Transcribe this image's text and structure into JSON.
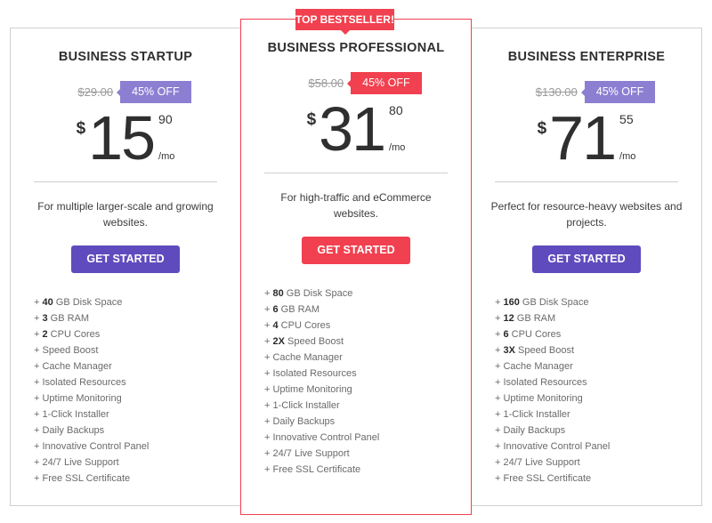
{
  "colors": {
    "accent_purple": "#5f4bbd",
    "badge_purple": "#8c7fd2",
    "accent_red": "#f1404f",
    "border_gray": "#cfcfcf"
  },
  "plans": [
    {
      "name": "BUSINESS STARTUP",
      "old_price": "$29.00",
      "discount": "45% OFF",
      "currency": "$",
      "price_whole": "15",
      "price_cents": "90",
      "period": "/mo",
      "description": "For multiple larger-scale and growing websites.",
      "cta": "GET STARTED",
      "features": [
        {
          "prefix": "+ ",
          "bold": "40",
          "text": " GB Disk Space"
        },
        {
          "prefix": "+ ",
          "bold": "3",
          "text": " GB RAM"
        },
        {
          "prefix": "+ ",
          "bold": "2",
          "text": " CPU Cores"
        },
        {
          "prefix": "+ ",
          "bold": "",
          "text": "Speed Boost"
        },
        {
          "prefix": "+ ",
          "bold": "",
          "text": "Cache Manager"
        },
        {
          "prefix": "+ ",
          "bold": "",
          "text": "Isolated Resources"
        },
        {
          "prefix": "+ ",
          "bold": "",
          "text": "Uptime Monitoring"
        },
        {
          "prefix": "+ ",
          "bold": "",
          "text": "1-Click Installer"
        },
        {
          "prefix": "+ ",
          "bold": "",
          "text": "Daily Backups"
        },
        {
          "prefix": "+ ",
          "bold": "",
          "text": "Innovative Control Panel"
        },
        {
          "prefix": "+ ",
          "bold": "",
          "text": "24/7 Live Support"
        },
        {
          "prefix": "+ ",
          "bold": "",
          "text": "Free SSL Certificate"
        }
      ]
    },
    {
      "ribbon": "TOP BESTSELLER!",
      "name": "BUSINESS PROFESSIONAL",
      "old_price": "$58.00",
      "discount": "45% OFF",
      "currency": "$",
      "price_whole": "31",
      "price_cents": "80",
      "period": "/mo",
      "description": "For high-traffic and eCommerce websites.",
      "cta": "GET STARTED",
      "features": [
        {
          "prefix": "+ ",
          "bold": "80",
          "text": " GB Disk Space"
        },
        {
          "prefix": "+ ",
          "bold": "6",
          "text": " GB RAM"
        },
        {
          "prefix": "+ ",
          "bold": "4",
          "text": " CPU Cores"
        },
        {
          "prefix": "+ ",
          "bold": "2X",
          "text": " Speed Boost"
        },
        {
          "prefix": "+ ",
          "bold": "",
          "text": "Cache Manager"
        },
        {
          "prefix": "+ ",
          "bold": "",
          "text": "Isolated Resources"
        },
        {
          "prefix": "+ ",
          "bold": "",
          "text": "Uptime Monitoring"
        },
        {
          "prefix": "+ ",
          "bold": "",
          "text": "1-Click Installer"
        },
        {
          "prefix": "+ ",
          "bold": "",
          "text": "Daily Backups"
        },
        {
          "prefix": "+ ",
          "bold": "",
          "text": "Innovative Control Panel"
        },
        {
          "prefix": "+ ",
          "bold": "",
          "text": "24/7 Live Support"
        },
        {
          "prefix": "+ ",
          "bold": "",
          "text": "Free SSL Certificate"
        }
      ]
    },
    {
      "name": "BUSINESS ENTERPRISE",
      "old_price": "$130.00",
      "discount": "45% OFF",
      "currency": "$",
      "price_whole": "71",
      "price_cents": "55",
      "period": "/mo",
      "description": "Perfect for resource-heavy websites and projects.",
      "cta": "GET STARTED",
      "features": [
        {
          "prefix": "+ ",
          "bold": "160",
          "text": " GB Disk Space"
        },
        {
          "prefix": "+ ",
          "bold": "12",
          "text": " GB RAM"
        },
        {
          "prefix": "+ ",
          "bold": "6",
          "text": " CPU Cores"
        },
        {
          "prefix": "+ ",
          "bold": "3X",
          "text": " Speed Boost"
        },
        {
          "prefix": "+ ",
          "bold": "",
          "text": "Cache Manager"
        },
        {
          "prefix": "+ ",
          "bold": "",
          "text": "Isolated Resources"
        },
        {
          "prefix": "+ ",
          "bold": "",
          "text": "Uptime Monitoring"
        },
        {
          "prefix": "+ ",
          "bold": "",
          "text": "1-Click Installer"
        },
        {
          "prefix": "+ ",
          "bold": "",
          "text": "Daily Backups"
        },
        {
          "prefix": "+ ",
          "bold": "",
          "text": "Innovative Control Panel"
        },
        {
          "prefix": "+ ",
          "bold": "",
          "text": "24/7 Live Support"
        },
        {
          "prefix": "+ ",
          "bold": "",
          "text": "Free SSL Certificate"
        }
      ]
    }
  ]
}
